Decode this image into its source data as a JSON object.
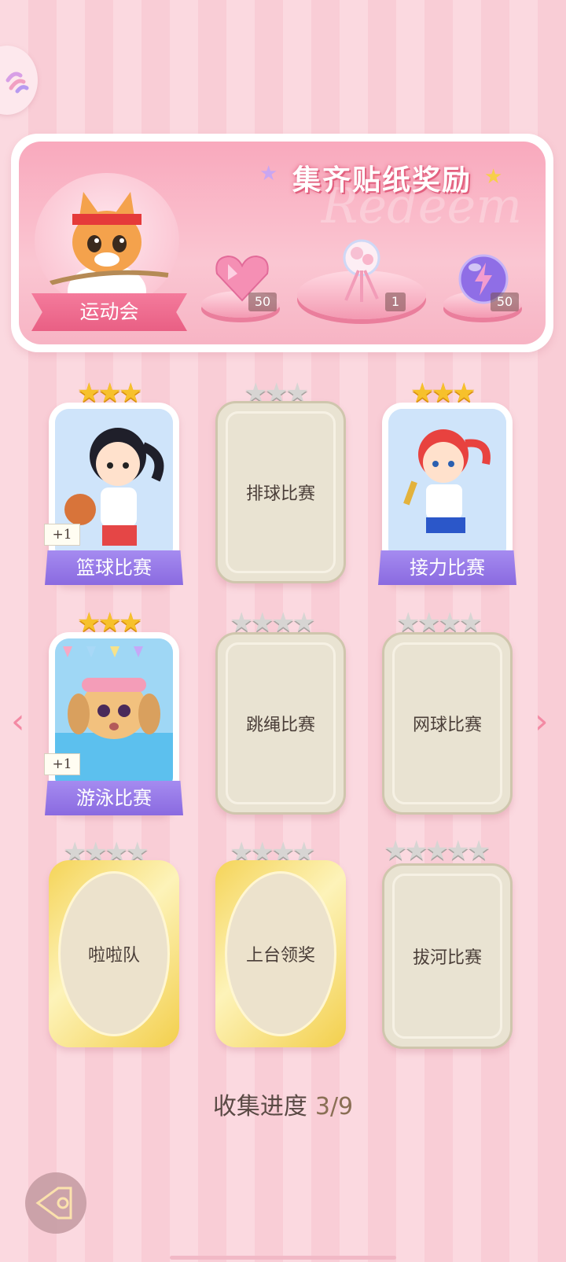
{
  "banner": {
    "title": "集齐贴纸奖励",
    "watermark": "Redeem",
    "event_label": "运动会",
    "rewards": [
      {
        "icon": "pink-heart-gem-icon",
        "count": "50"
      },
      {
        "icon": "ribbon-bouquet-icon",
        "count": "1"
      },
      {
        "icon": "purple-lightning-orb-icon",
        "count": "50"
      }
    ]
  },
  "stickers": [
    {
      "name": "篮球比赛",
      "stars": 3,
      "max_stars": 3,
      "collected": true,
      "bonus": "+1",
      "frame": "unlocked"
    },
    {
      "name": "排球比赛",
      "stars": 0,
      "max_stars": 3,
      "collected": false,
      "frame": "beige"
    },
    {
      "name": "接力比赛",
      "stars": 3,
      "max_stars": 3,
      "collected": true,
      "frame": "unlocked"
    },
    {
      "name": "游泳比赛",
      "stars": 3,
      "max_stars": 3,
      "collected": true,
      "bonus": "+1",
      "frame": "unlocked"
    },
    {
      "name": "跳绳比赛",
      "stars": 0,
      "max_stars": 4,
      "collected": false,
      "frame": "beige"
    },
    {
      "name": "网球比赛",
      "stars": 0,
      "max_stars": 4,
      "collected": false,
      "frame": "beige"
    },
    {
      "name": "啦啦队",
      "stars": 0,
      "max_stars": 4,
      "collected": false,
      "frame": "gold"
    },
    {
      "name": "上台领奖",
      "stars": 0,
      "max_stars": 4,
      "collected": false,
      "frame": "gold"
    },
    {
      "name": "拔河比赛",
      "stars": 0,
      "max_stars": 5,
      "collected": false,
      "frame": "beige"
    }
  ],
  "progress": {
    "label": "收集进度",
    "value": "3/9"
  },
  "colors": {
    "accent_pink": "#f47b9c",
    "ribbon_purple": "#8a6ae0",
    "star_gold": "#f7c12b"
  }
}
